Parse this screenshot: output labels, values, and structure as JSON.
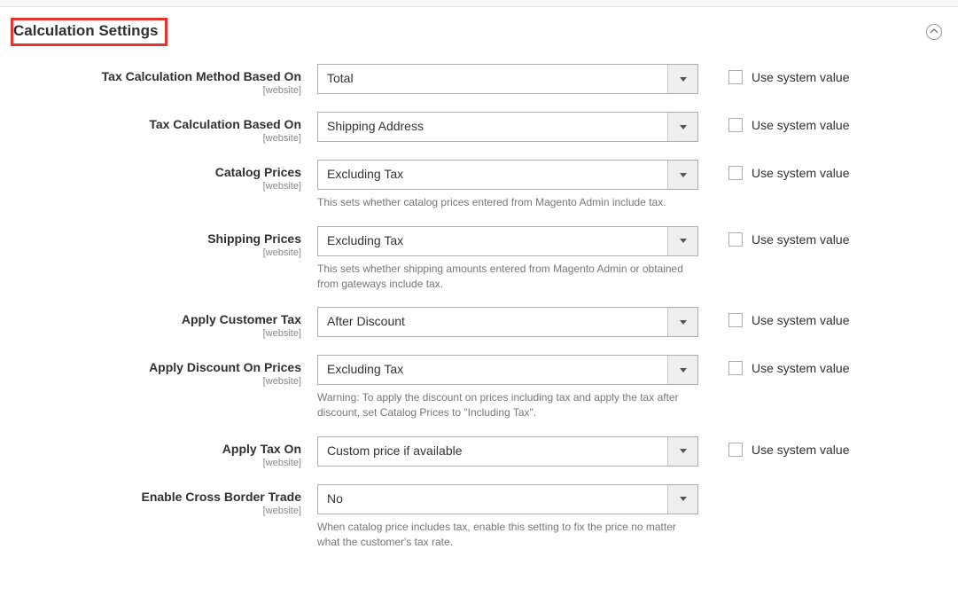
{
  "section": {
    "title": "Calculation Settings"
  },
  "scope_label": "[website]",
  "use_system_value_label": "Use system value",
  "fields": {
    "tax_calc_method": {
      "label": "Tax Calculation Method Based On",
      "value": "Total"
    },
    "tax_calc_based_on": {
      "label": "Tax Calculation Based On",
      "value": "Shipping Address"
    },
    "catalog_prices": {
      "label": "Catalog Prices",
      "value": "Excluding Tax",
      "help": "This sets whether catalog prices entered from Magento Admin include tax."
    },
    "shipping_prices": {
      "label": "Shipping Prices",
      "value": "Excluding Tax",
      "help": "This sets whether shipping amounts entered from Magento Admin or obtained from gateways include tax."
    },
    "apply_customer_tax": {
      "label": "Apply Customer Tax",
      "value": "After Discount"
    },
    "apply_discount_on_prices": {
      "label": "Apply Discount On Prices",
      "value": "Excluding Tax",
      "help": "Warning: To apply the discount on prices including tax and apply the tax after discount, set Catalog Prices to \"Including Tax\"."
    },
    "apply_tax_on": {
      "label": "Apply Tax On",
      "value": "Custom price if available"
    },
    "enable_cross_border": {
      "label": "Enable Cross Border Trade",
      "value": "No",
      "help": "When catalog price includes tax, enable this setting to fix the price no matter what the customer's tax rate."
    }
  }
}
